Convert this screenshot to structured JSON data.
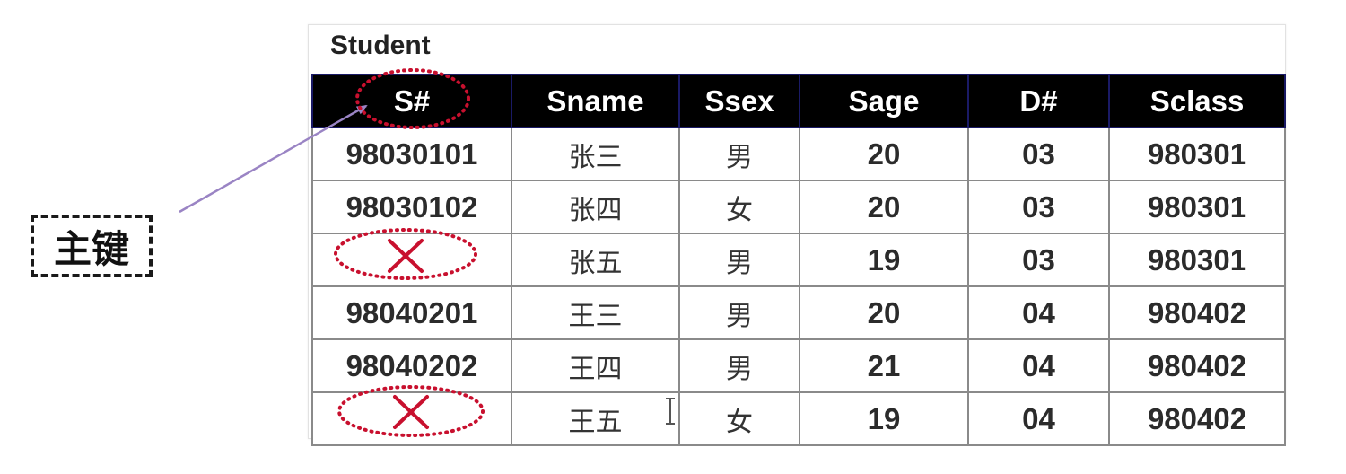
{
  "annotation": {
    "label": "主键"
  },
  "table": {
    "name": "Student",
    "columns": [
      "S#",
      "Sname",
      "Ssex",
      "Sage",
      "D#",
      "Sclass"
    ],
    "rows": [
      [
        "98030101",
        "张三",
        "男",
        "20",
        "03",
        "980301"
      ],
      [
        "98030102",
        "张四",
        "女",
        "20",
        "03",
        "980301"
      ],
      [
        "",
        "张五",
        "男",
        "19",
        "03",
        "980301"
      ],
      [
        "98040201",
        "王三",
        "男",
        "20",
        "04",
        "980402"
      ],
      [
        "98040202",
        "王四",
        "男",
        "21",
        "04",
        "980402"
      ],
      [
        "",
        "王五",
        "女",
        "19",
        "04",
        "980402"
      ]
    ]
  },
  "colors": {
    "header_bg": "#000000",
    "marker_red": "#c8102e",
    "arrow": "#9a84c4"
  },
  "icons": [
    "cross-icon",
    "dotted-ellipse-marker",
    "text-cursor-icon"
  ]
}
